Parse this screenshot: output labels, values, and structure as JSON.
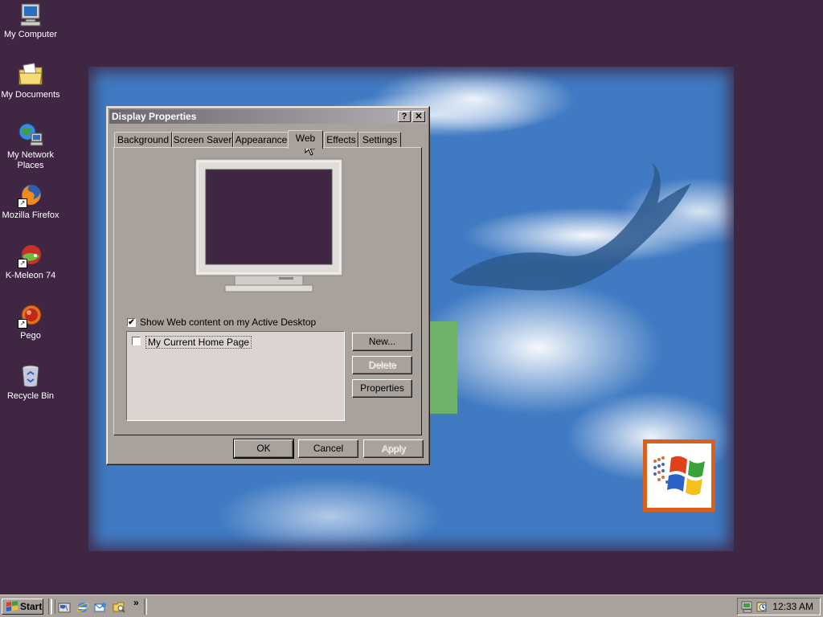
{
  "desktop": {
    "icons": [
      {
        "label": "My Computer",
        "icon": "my-computer-icon"
      },
      {
        "label": "My Documents",
        "icon": "my-documents-icon"
      },
      {
        "label": "My Network Places",
        "icon": "network-places-icon"
      },
      {
        "label": "Mozilla Firefox",
        "icon": "firefox-icon"
      },
      {
        "label": "K-Meleon 74",
        "icon": "k-meleon-icon"
      },
      {
        "label": "Pego",
        "icon": "pego-icon"
      },
      {
        "label": "Recycle Bin",
        "icon": "recycle-bin-icon"
      }
    ]
  },
  "dialog": {
    "title": "Display Properties",
    "help_button": "?",
    "close_button": "✕",
    "tabs": [
      {
        "label": "Background"
      },
      {
        "label": "Screen Saver"
      },
      {
        "label": "Appearance"
      },
      {
        "label": "Web",
        "active": true
      },
      {
        "label": "Effects"
      },
      {
        "label": "Settings"
      }
    ],
    "show_web_content": {
      "label": "Show Web content on my Active Desktop",
      "checked": true
    },
    "web_items": [
      {
        "label": "My Current Home Page",
        "checked": false
      }
    ],
    "side_buttons": {
      "new": "New...",
      "delete": "Delete",
      "properties": "Properties"
    },
    "footer_buttons": {
      "ok": "OK",
      "cancel": "Cancel",
      "apply": "Apply"
    }
  },
  "taskbar": {
    "start_label": "Start",
    "quick_launch": [
      "show-desktop-icon",
      "internet-explorer-icon",
      "outlook-express-icon",
      "explorer-icon"
    ],
    "overflow": "»",
    "clock": "12:33 AM"
  },
  "colors": {
    "desktop": "#3f2744",
    "wallpaper_sky": "#3f7ac2",
    "dialog_face": "#a9a19b",
    "logo_tile": "#d8601c"
  }
}
